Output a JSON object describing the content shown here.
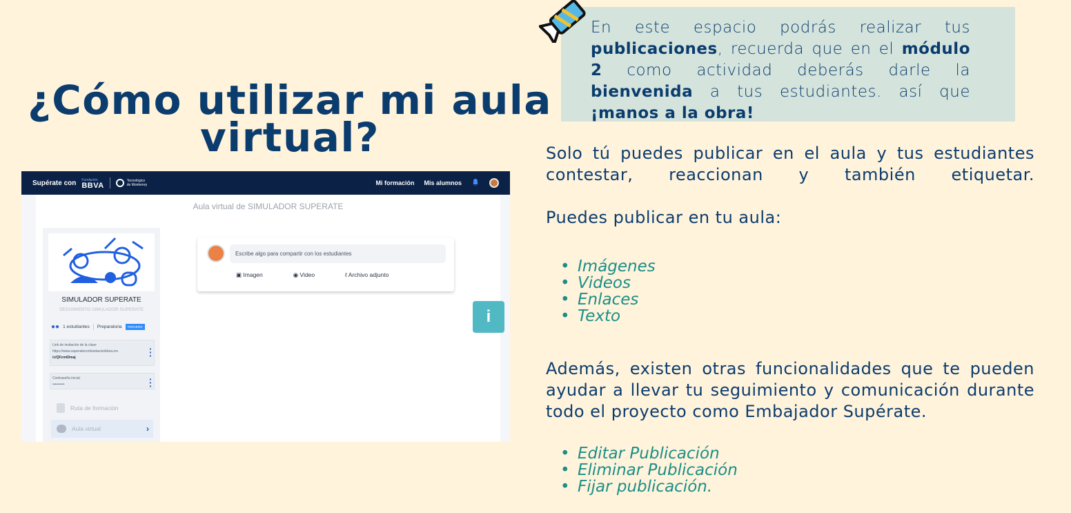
{
  "title": {
    "line1": "¿Cómo utilizar mi aula",
    "line2": "virtual?"
  },
  "screenshot": {
    "nav": {
      "brand": "Supérate con",
      "fundacion": "Fundación",
      "bbva": "BBVA",
      "tec_line1": "Tecnológico",
      "tec_line2": "de Monterrey",
      "items": [
        "Mi formación",
        "Mis alumnos"
      ]
    },
    "page_title": "Aula virtual de SIMULADOR SUPERATE",
    "class_name": "SIMULADOR SUPERATE",
    "class_subtitle": "SEGUIMIENTO SIMULADOR SUPERATE",
    "students": "1 estudiantes",
    "level": "Preparatoria",
    "grade_tag": "TERCERO",
    "invite_label": "Link de invitación de la clase",
    "invite_url": "https://www.superateconfundacionbbva.mx",
    "invite_code": "/c/QFcmtDmaj",
    "password_label": "Contraseña inicial",
    "password_value": "••••••••••",
    "menu": [
      "Ruta de formación",
      "Aula virtual"
    ],
    "post_placeholder": "Escribe algo para compartir con los estudiantes",
    "post_actions": [
      "Imagen",
      "Video",
      "Archivo adjunto"
    ],
    "info_label": "i"
  },
  "callout": {
    "p1": "En este espacio podrás realizar tus ",
    "b1": "publicaciones",
    "p2": ", recuerda que en el ",
    "b2": "módulo 2",
    "p3": " como actividad deberás darle la ",
    "b3": "bienvenida",
    "p4": " a tus estudiantes. así que ",
    "b4": "¡manos a la obra!"
  },
  "para1": "Solo tú puedes publicar en el aula y tus estudiantes contestar, reaccionan y también etiquetar.",
  "para2": "Puedes publicar en tu aula:",
  "list1": [
    "Imágenes",
    "Videos",
    "Enlaces",
    "Texto"
  ],
  "para3": "Además, existen otras funcionalidades que te pueden ayudar a llevar tu seguimiento y comunicación durante todo el proyecto como Embajador Supérate.",
  "list2": [
    "Editar Publicación",
    "Eliminar Publicación",
    "Fijar publicación."
  ],
  "colors": {
    "background": "#fff3dc",
    "navy": "#0b3c6e",
    "teal": "#1a8e86",
    "callout": "#d4e4dc"
  }
}
